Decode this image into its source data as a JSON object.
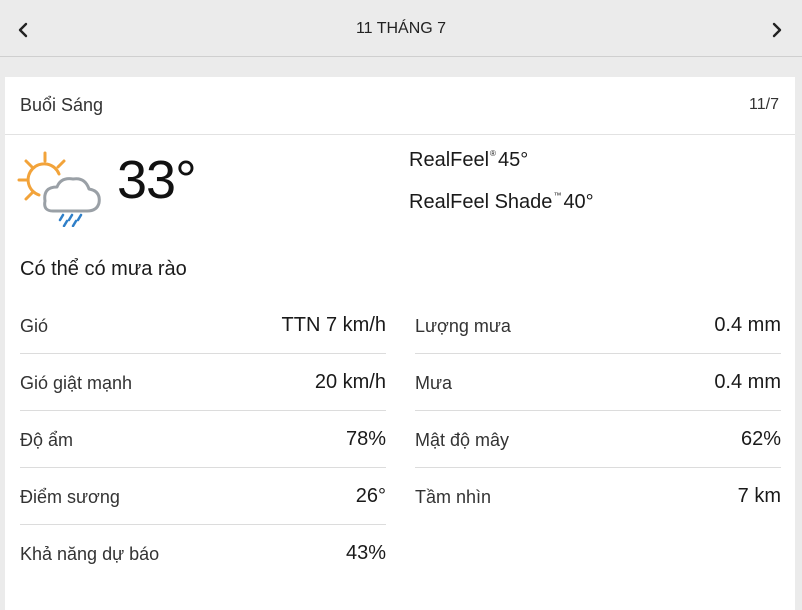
{
  "header": {
    "date_title": "11 THÁNG 7",
    "prev_icon": "chevron-left-icon",
    "next_icon": "chevron-right-icon"
  },
  "card": {
    "period": "Buổi Sáng",
    "short_date": "11/7",
    "icon": "partly-sunny-showers-icon",
    "temperature": "33°",
    "realfeel": {
      "label": "RealFeel",
      "mark": "®",
      "value": "45°"
    },
    "realfeel_shade": {
      "label": "RealFeel Shade",
      "mark": "™",
      "value": "40°"
    },
    "phrase": "Có thể có mưa rào"
  },
  "details_left": [
    {
      "label": "Gió",
      "value": "TTN 7 km/h"
    },
    {
      "label": "Gió giật mạnh",
      "value": "20 km/h"
    },
    {
      "label": "Độ ẩm",
      "value": "78%"
    },
    {
      "label": "Điểm sương",
      "value": "26°"
    },
    {
      "label": "Khả năng dự báo",
      "value": "43%"
    }
  ],
  "details_right": [
    {
      "label": "Lượng mưa",
      "value": "0.4 mm"
    },
    {
      "label": "Mưa",
      "value": "0.4 mm"
    },
    {
      "label": "Mật độ mây",
      "value": "62%"
    },
    {
      "label": "Tầm nhìn",
      "value": "7 km"
    }
  ],
  "colors": {
    "sun": "#f2a33a",
    "cloud": "#9aa0a6",
    "rain": "#2f7fc8"
  }
}
